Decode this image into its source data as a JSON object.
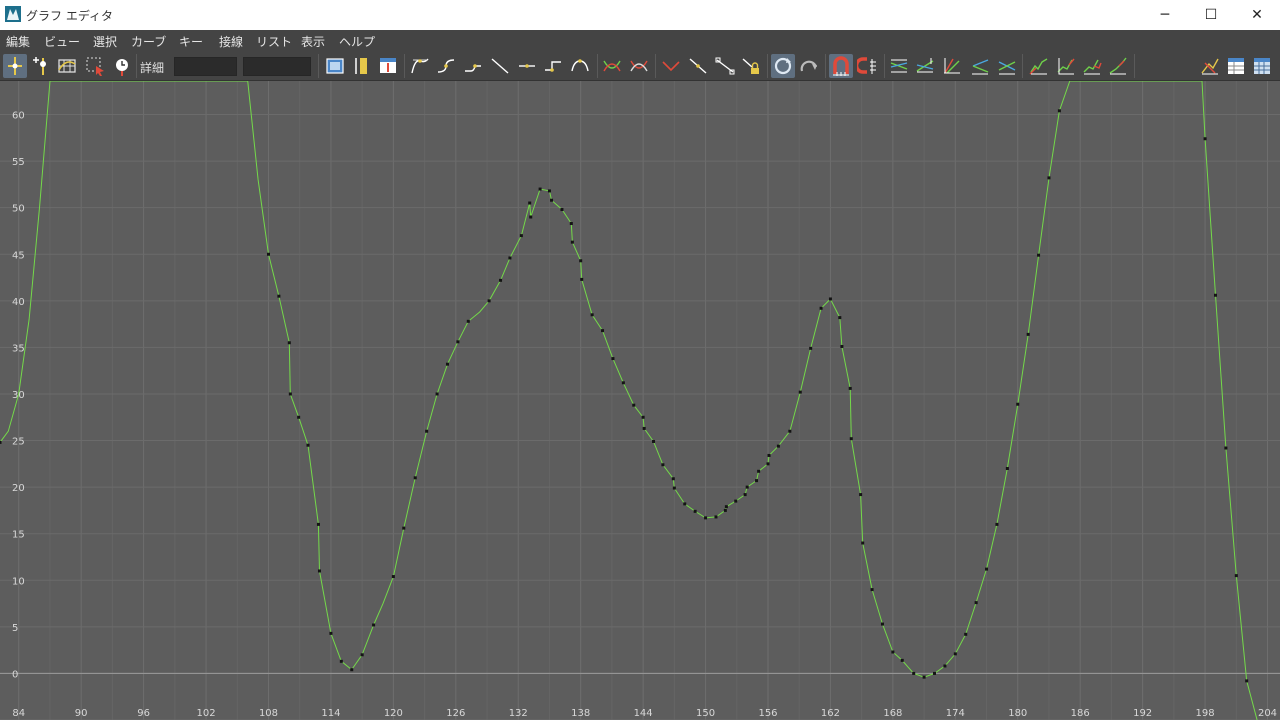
{
  "window": {
    "title": "グラフ エディタ",
    "minimize_label": "─",
    "maximize_label": "☐",
    "close_label": "✕"
  },
  "menu": [
    "編集",
    "ビュー",
    "選択",
    "カーブ",
    "キー",
    "接線",
    "リスト",
    "表示",
    "ヘルプ"
  ],
  "toolbar": {
    "detail_label": "詳細",
    "field1_value": "",
    "field2_value": ""
  },
  "colors": {
    "background": "#5d5d5d",
    "grid": "#6b6b6b",
    "curve": "#74d94a",
    "key": "#141414",
    "zero_line": "#9a9a9a",
    "toolbar": "#444444"
  },
  "chart_data": {
    "type": "line",
    "title": "",
    "xlabel": "",
    "ylabel": "",
    "xlim": [
      82.2,
      205.2
    ],
    "ylim": [
      -5,
      63.6
    ],
    "x_ticks": [
      84,
      90,
      96,
      102,
      108,
      114,
      120,
      126,
      132,
      138,
      144,
      150,
      156,
      162,
      168,
      174,
      180,
      186,
      192,
      198,
      204
    ],
    "y_ticks": [
      0,
      5,
      10,
      15,
      20,
      25,
      30,
      35,
      40,
      45,
      50,
      55,
      60
    ],
    "grid": true,
    "series": [
      {
        "curve": [
          [
            82.2,
            24.8
          ],
          [
            83,
            26
          ],
          [
            84,
            30
          ],
          [
            85,
            38
          ],
          [
            86,
            50
          ],
          [
            87,
            63.6
          ],
          [
            106,
            63.6
          ],
          [
            107,
            53
          ],
          [
            108,
            45
          ],
          [
            109,
            40.5
          ],
          [
            110,
            35.5
          ],
          [
            110.1,
            30
          ],
          [
            110.9,
            27.5
          ],
          [
            111.8,
            24.5
          ],
          [
            112.8,
            16
          ],
          [
            112.9,
            11
          ],
          [
            114,
            4.3
          ],
          [
            115,
            1.3
          ],
          [
            116,
            0.4
          ],
          [
            117,
            2
          ],
          [
            118.1,
            5.2
          ],
          [
            119,
            7.5
          ],
          [
            120,
            10.4
          ],
          [
            121,
            15.6
          ],
          [
            122.1,
            21
          ],
          [
            123.2,
            26
          ],
          [
            124.2,
            30
          ],
          [
            125.2,
            33.2
          ],
          [
            126.2,
            35.6
          ],
          [
            127.2,
            37.8
          ],
          [
            128.3,
            38.8
          ],
          [
            129.2,
            40
          ],
          [
            130.3,
            42.2
          ],
          [
            131.2,
            44.6
          ],
          [
            132.3,
            47
          ],
          [
            133.1,
            50.5
          ],
          [
            133.2,
            49
          ],
          [
            134.1,
            52
          ],
          [
            135,
            51.8
          ],
          [
            135.2,
            50.8
          ],
          [
            136.2,
            49.8
          ],
          [
            137.1,
            48.3
          ],
          [
            137.2,
            46.3
          ],
          [
            138,
            44.3
          ],
          [
            138.1,
            42.3
          ],
          [
            139.1,
            38.5
          ],
          [
            140.1,
            36.8
          ],
          [
            141.1,
            33.8
          ],
          [
            142.1,
            31.2
          ],
          [
            143.1,
            28.8
          ],
          [
            144,
            27.5
          ],
          [
            144.1,
            26.3
          ],
          [
            145,
            24.9
          ],
          [
            145.9,
            22.4
          ],
          [
            146.9,
            20.9
          ],
          [
            147,
            19.9
          ],
          [
            148,
            18.2
          ],
          [
            149,
            17.4
          ],
          [
            150,
            16.7
          ],
          [
            151,
            16.8
          ],
          [
            151.9,
            17.5
          ],
          [
            152,
            17.9
          ],
          [
            152.9,
            18.5
          ],
          [
            153.8,
            19.2
          ],
          [
            154,
            20
          ],
          [
            154.9,
            20.7
          ],
          [
            155.1,
            21.7
          ],
          [
            156,
            22.5
          ],
          [
            156.1,
            23.4
          ],
          [
            157,
            24.4
          ],
          [
            158.1,
            26
          ],
          [
            159.1,
            30.2
          ],
          [
            160.1,
            34.9
          ],
          [
            161.1,
            39.2
          ],
          [
            162,
            40.2
          ],
          [
            162.9,
            38.2
          ],
          [
            163.1,
            35.1
          ],
          [
            163.9,
            30.6
          ],
          [
            164,
            25.2
          ],
          [
            164.9,
            19.2
          ],
          [
            165.1,
            14
          ],
          [
            166,
            9
          ],
          [
            167,
            5.3
          ],
          [
            168,
            2.3
          ],
          [
            168.9,
            1.4
          ],
          [
            170,
            0
          ],
          [
            171,
            -0.4
          ],
          [
            172,
            0
          ],
          [
            173,
            0.8
          ],
          [
            174,
            2.1
          ],
          [
            175,
            4.2
          ],
          [
            176,
            7.6
          ],
          [
            177,
            11.2
          ],
          [
            178,
            16
          ],
          [
            179,
            22
          ],
          [
            180,
            28.9
          ],
          [
            181,
            36.4
          ],
          [
            182,
            44.9
          ],
          [
            183,
            53.2
          ],
          [
            184,
            60.4
          ],
          [
            185,
            63.6
          ],
          [
            197.7,
            63.6
          ],
          [
            198,
            57.4
          ],
          [
            199,
            40.6
          ],
          [
            200,
            24.2
          ],
          [
            201,
            10.5
          ],
          [
            202,
            -0.8
          ],
          [
            203,
            -5
          ]
        ],
        "keys": [
          [
            82.2,
            24.8
          ],
          [
            108,
            45
          ],
          [
            109,
            40.5
          ],
          [
            110,
            35.5
          ],
          [
            110.1,
            30
          ],
          [
            110.9,
            27.5
          ],
          [
            111.8,
            24.5
          ],
          [
            112.8,
            16
          ],
          [
            112.9,
            11
          ],
          [
            114,
            4.3
          ],
          [
            115,
            1.3
          ],
          [
            116,
            0.4
          ],
          [
            117,
            2
          ],
          [
            118.1,
            5.2
          ],
          [
            120,
            10.4
          ],
          [
            121,
            15.6
          ],
          [
            122.1,
            21
          ],
          [
            123.2,
            26
          ],
          [
            124.2,
            30
          ],
          [
            125.2,
            33.2
          ],
          [
            126.2,
            35.6
          ],
          [
            127.2,
            37.8
          ],
          [
            129.2,
            40
          ],
          [
            130.3,
            42.2
          ],
          [
            131.2,
            44.6
          ],
          [
            132.3,
            47
          ],
          [
            133.1,
            50.5
          ],
          [
            133.2,
            49
          ],
          [
            134.1,
            52
          ],
          [
            135,
            51.8
          ],
          [
            135.2,
            50.8
          ],
          [
            136.2,
            49.8
          ],
          [
            137.1,
            48.3
          ],
          [
            137.2,
            46.3
          ],
          [
            138,
            44.3
          ],
          [
            138.1,
            42.3
          ],
          [
            139.1,
            38.5
          ],
          [
            140.1,
            36.8
          ],
          [
            141.1,
            33.8
          ],
          [
            142.1,
            31.2
          ],
          [
            143.1,
            28.8
          ],
          [
            144,
            27.5
          ],
          [
            144.1,
            26.3
          ],
          [
            145,
            24.9
          ],
          [
            145.9,
            22.4
          ],
          [
            146.9,
            20.9
          ],
          [
            147,
            19.9
          ],
          [
            148,
            18.2
          ],
          [
            149,
            17.4
          ],
          [
            150,
            16.7
          ],
          [
            151,
            16.8
          ],
          [
            151.9,
            17.5
          ],
          [
            152,
            17.9
          ],
          [
            152.9,
            18.5
          ],
          [
            153.8,
            19.2
          ],
          [
            154,
            20
          ],
          [
            154.9,
            20.7
          ],
          [
            155.1,
            21.7
          ],
          [
            156,
            22.5
          ],
          [
            156.1,
            23.4
          ],
          [
            157,
            24.4
          ],
          [
            158.1,
            26
          ],
          [
            159.1,
            30.2
          ],
          [
            160.1,
            34.9
          ],
          [
            161.1,
            39.2
          ],
          [
            162,
            40.2
          ],
          [
            162.9,
            38.2
          ],
          [
            163.1,
            35.1
          ],
          [
            163.9,
            30.6
          ],
          [
            164,
            25.2
          ],
          [
            164.9,
            19.2
          ],
          [
            165.1,
            14
          ],
          [
            166,
            9
          ],
          [
            167,
            5.3
          ],
          [
            168,
            2.3
          ],
          [
            168.9,
            1.4
          ],
          [
            170,
            0
          ],
          [
            171,
            -0.4
          ],
          [
            172,
            0
          ],
          [
            173,
            0.8
          ],
          [
            174,
            2.1
          ],
          [
            175,
            4.2
          ],
          [
            176,
            7.6
          ],
          [
            177,
            11.2
          ],
          [
            178,
            16
          ],
          [
            179,
            22
          ],
          [
            180,
            28.9
          ],
          [
            181,
            36.4
          ],
          [
            182,
            44.9
          ],
          [
            183,
            53.2
          ],
          [
            184,
            60.4
          ],
          [
            198,
            57.4
          ],
          [
            199,
            40.6
          ],
          [
            200,
            24.2
          ],
          [
            201,
            10.5
          ],
          [
            202,
            -0.8
          ]
        ]
      }
    ]
  },
  "icons": [
    "move-key-tool-icon",
    "insert-key-tool-icon",
    "lattice-deform-icon",
    "region-select-icon",
    "retime-tool-icon",
    "frame-all-icon",
    "frame-playback-icon",
    "center-current-time-icon",
    "auto-tangent-icon",
    "spline-tangent-icon",
    "clamped-tangent-icon",
    "linear-tangent-icon",
    "flat-tangent-icon",
    "step-tangent-icon",
    "plateau-tangent-icon",
    "buffer-curve-snapshot-icon",
    "swap-buffer-curve-icon",
    "break-tangents-icon",
    "unify-tangents-icon",
    "free-tangent-weight-icon",
    "lock-tangent-weight-icon",
    "auto-load-icon",
    "load-selected-icon",
    "time-snap-icon",
    "value-snap-icon",
    "normalize-icon",
    "denormalize-icon",
    "absolute-view-icon",
    "stacked-view-icon",
    "relative-view-icon",
    "pre-infinity-cycle-icon",
    "post-infinity-cycle-icon",
    "pre-infinity-offset-icon",
    "post-infinity-offset-icon",
    "open-dope-sheet-icon",
    "open-trax-editor-icon",
    "spreadsheet-icon"
  ]
}
